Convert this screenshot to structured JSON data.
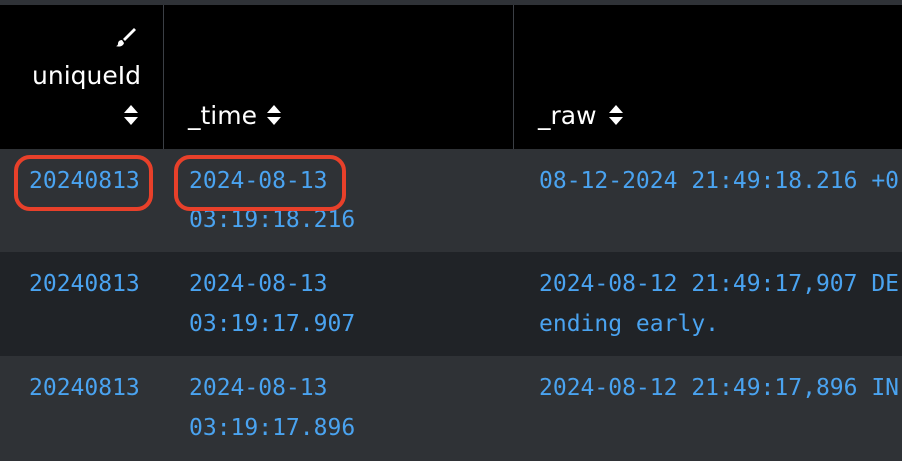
{
  "columns": [
    {
      "label": "uniqueId"
    },
    {
      "label": "_time"
    },
    {
      "label": "_raw"
    }
  ],
  "rows": [
    {
      "id": "20240813",
      "time_line1": "2024-08-13",
      "time_line2": "03:19:18.216",
      "raw_line1": "08-12-2024 21:49:18.216 +0",
      "raw_line2": ""
    },
    {
      "id": "20240813",
      "time_line1": "2024-08-13",
      "time_line2": "03:19:17.907",
      "raw_line1": "2024-08-12 21:49:17,907 DE",
      "raw_line2": "ending early."
    },
    {
      "id": "20240813",
      "time_line1": "2024-08-13",
      "time_line2": "03:19:17.896",
      "raw_line1": "2024-08-12 21:49:17,896 IN",
      "raw_line2": ""
    }
  ],
  "icons": {
    "column_format": "paintbrush-icon",
    "sort": "sort-icon"
  },
  "colors": {
    "header_bg": "#000000",
    "row_light": "#2f3236",
    "row_dark": "#202327",
    "link_text": "#4aa3f0",
    "highlight": "#e8402a"
  }
}
